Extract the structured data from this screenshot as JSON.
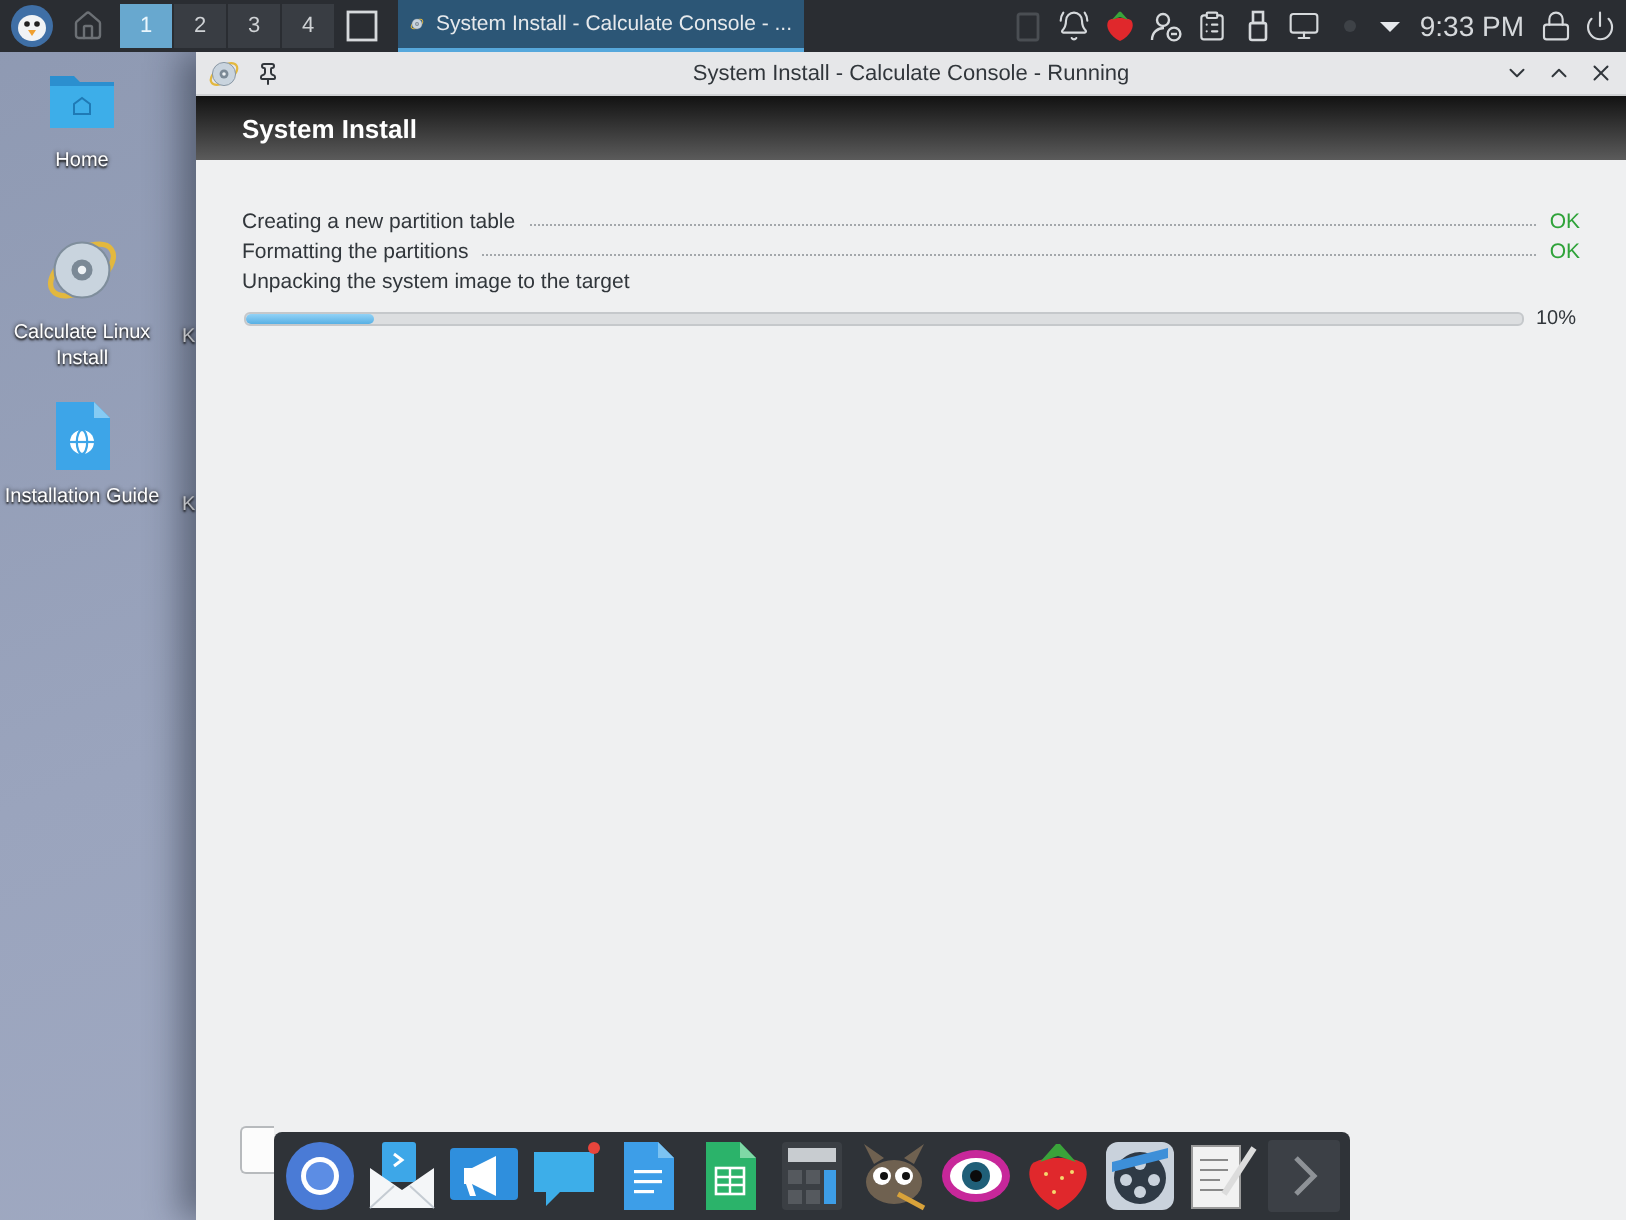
{
  "panel": {
    "pager": [
      {
        "label": "1",
        "selected": true
      },
      {
        "label": "2",
        "selected": false
      },
      {
        "label": "3",
        "selected": false
      },
      {
        "label": "4",
        "selected": false
      }
    ],
    "task": {
      "title": "System Install - Calculate Console - ...",
      "selected": true
    },
    "clock": "9:33 PM"
  },
  "desktop": {
    "icons": [
      {
        "kind": "folder",
        "label": "Home"
      },
      {
        "kind": "disc",
        "label": "Calculate Linux Install"
      },
      {
        "kind": "document",
        "label": "Installation Guide"
      }
    ],
    "covered_labels": [
      "K",
      "K"
    ]
  },
  "window": {
    "title": "System Install - Calculate Console - Running",
    "header": "System Install",
    "steps": [
      {
        "label": "Creating a new partition table",
        "status": "OK"
      },
      {
        "label": "Formatting the partitions",
        "status": "OK"
      },
      {
        "label": "Unpacking the system image to the target"
      }
    ],
    "progress": {
      "level": 0.1,
      "reading": "10%"
    }
  },
  "dock": {
    "apps": [
      {
        "kind": "browser",
        "notification": false
      },
      {
        "kind": "mail",
        "notification": false
      },
      {
        "kind": "megaphone",
        "notification": false
      },
      {
        "kind": "chat",
        "notification": true
      },
      {
        "kind": "document",
        "notification": false
      },
      {
        "kind": "spreadsheet",
        "notification": false
      },
      {
        "kind": "calculator",
        "notification": false
      },
      {
        "kind": "creature",
        "notification": false
      },
      {
        "kind": "eye",
        "notification": false
      },
      {
        "kind": "strawberry",
        "notification": false
      },
      {
        "kind": "film",
        "notification": false
      },
      {
        "kind": "notepad",
        "notification": false
      },
      {
        "kind": "more",
        "notification": false
      }
    ]
  }
}
